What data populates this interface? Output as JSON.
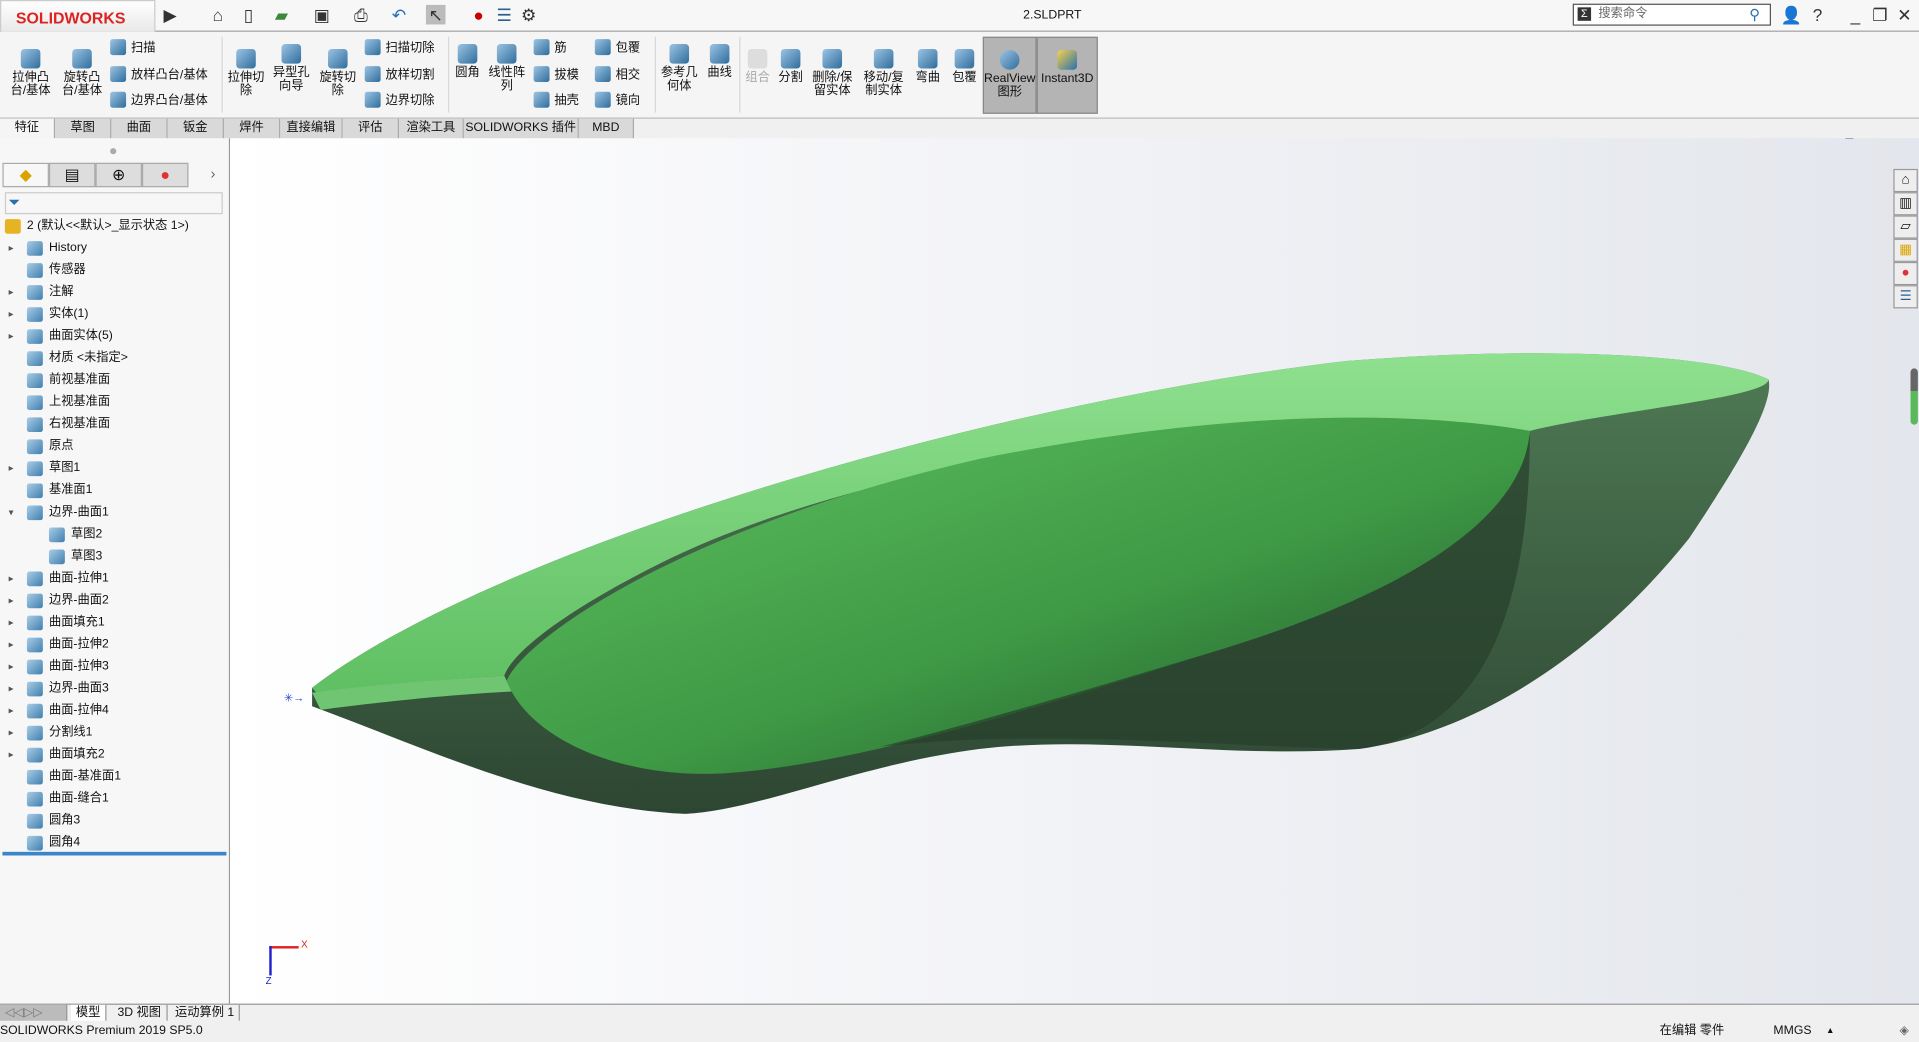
{
  "app": {
    "logo": "SOLIDWORKS",
    "document_title": "2.SLDPRT",
    "search_placeholder": "搜索命令"
  },
  "ribbon": {
    "big": [
      {
        "label": "拉伸凸\n台/基体"
      },
      {
        "label": "旋转凸\n台/基体"
      },
      {
        "label": "拉伸切\n除"
      },
      {
        "label": "异型孔\n向导"
      },
      {
        "label": "旋转切\n除"
      },
      {
        "label": "圆角"
      },
      {
        "label": "线性阵\n列"
      },
      {
        "label": "参考几\n何体"
      },
      {
        "label": "曲线"
      },
      {
        "label": "组合"
      },
      {
        "label": "分割"
      },
      {
        "label": "删除/保\n留实体"
      },
      {
        "label": "移动/复\n制实体"
      },
      {
        "label": "弯曲"
      },
      {
        "label": "包覆"
      },
      {
        "label": "RealView\n图形"
      },
      {
        "label": "Instant3D"
      }
    ],
    "small": [
      "扫描",
      "放样凸台/基体",
      "边界凸台/基体",
      "扫描切除",
      "放样切割",
      "边界切除",
      "筋",
      "拔模",
      "抽壳",
      "包覆",
      "相交",
      "镜向"
    ]
  },
  "tabs": [
    "特征",
    "草图",
    "曲面",
    "钣金",
    "焊件",
    "直接编辑",
    "评估",
    "渲染工具",
    "SOLIDWORKS 插件",
    "MBD"
  ],
  "active_tab": "特征",
  "tree": {
    "root": "2  (默认<<默认>_显示状态 1>)",
    "items": [
      {
        "label": "History",
        "expand": true
      },
      {
        "label": "传感器",
        "expand": false
      },
      {
        "label": "注解",
        "expand": true
      },
      {
        "label": "实体(1)",
        "expand": true
      },
      {
        "label": "曲面实体(5)",
        "expand": true
      },
      {
        "label": "材质 <未指定>",
        "expand": false
      },
      {
        "label": "前视基准面",
        "expand": false
      },
      {
        "label": "上视基准面",
        "expand": false
      },
      {
        "label": "右视基准面",
        "expand": false
      },
      {
        "label": "原点",
        "expand": false
      },
      {
        "label": "草图1",
        "expand": true
      },
      {
        "label": "基准面1",
        "expand": false
      },
      {
        "label": "边界-曲面1",
        "expand": "open"
      },
      {
        "label": "草图2",
        "child": true
      },
      {
        "label": "草图3",
        "child": true
      },
      {
        "label": "曲面-拉伸1",
        "expand": true
      },
      {
        "label": "边界-曲面2",
        "expand": true
      },
      {
        "label": "曲面填充1",
        "expand": true
      },
      {
        "label": "曲面-拉伸2",
        "expand": true
      },
      {
        "label": "曲面-拉伸3",
        "expand": true
      },
      {
        "label": "边界-曲面3",
        "expand": true
      },
      {
        "label": "曲面-拉伸4",
        "expand": true
      },
      {
        "label": "分割线1",
        "expand": true
      },
      {
        "label": "曲面填充2",
        "expand": true
      },
      {
        "label": "曲面-基准面1",
        "expand": false
      },
      {
        "label": "曲面-缝合1",
        "expand": false
      },
      {
        "label": "圆角3",
        "expand": false
      },
      {
        "label": "圆角4",
        "expand": false
      }
    ]
  },
  "bottom_tabs": [
    "模型",
    "3D 视图",
    "运动算例 1"
  ],
  "status": {
    "version": "SOLIDWORKS Premium 2019 SP5.0",
    "mode": "在编辑 零件",
    "units": "MMGS"
  },
  "triad": {
    "x": "X",
    "z": "Z"
  },
  "colors": {
    "model_light": "#7fd07f",
    "model_dark": "#2f4a35",
    "accent": "#d22222",
    "selection_bar": "#3b86c8"
  }
}
